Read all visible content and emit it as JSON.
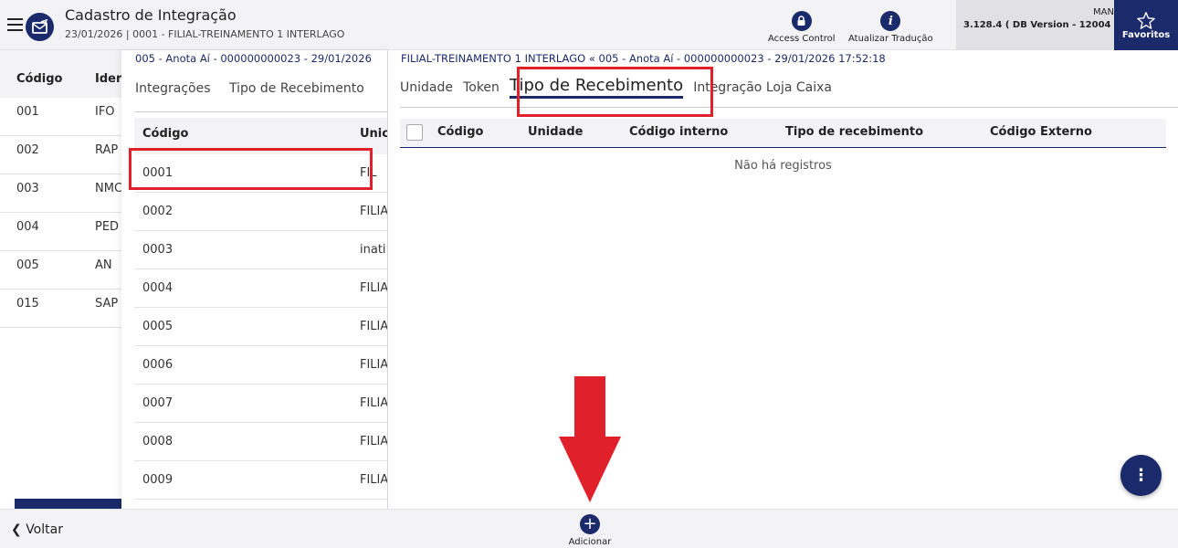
{
  "header": {
    "title": "Cadastro de Integração",
    "subtitle": "23/01/2026 | 0001 - FILIAL-TREINAMENTO 1 INTERLAGO",
    "access_control_label": "Access Control",
    "atualizar_traducao_label": "Atualizar Tradução",
    "user": "MAN",
    "version": "3.128.4 ( DB Version - 12004 )",
    "favoritos_label": "Favoritos"
  },
  "left_table": {
    "headers": [
      "Código",
      "Ider"
    ],
    "rows": [
      {
        "code": "001",
        "id": "IFO"
      },
      {
        "code": "002",
        "id": "RAP"
      },
      {
        "code": "003",
        "id": "NMC"
      },
      {
        "code": "004",
        "id": "PED"
      },
      {
        "code": "005",
        "id": "AN"
      },
      {
        "code": "015",
        "id": "SAP"
      }
    ]
  },
  "middle_panel": {
    "breadcrumb": "005 - Anota Aí - 000000000023 - 29/01/2026",
    "tabs": [
      "Integrações",
      "Tipo de Recebimento"
    ],
    "headers": [
      "Código",
      "Unic"
    ],
    "rows": [
      {
        "code": "0001",
        "unit": "FIL"
      },
      {
        "code": "0002",
        "unit": "FILIA"
      },
      {
        "code": "0003",
        "unit": "inati"
      },
      {
        "code": "0004",
        "unit": "FILIA"
      },
      {
        "code": "0005",
        "unit": "FILIA"
      },
      {
        "code": "0006",
        "unit": "FILIA"
      },
      {
        "code": "0007",
        "unit": "FILIA"
      },
      {
        "code": "0008",
        "unit": "FILIA"
      },
      {
        "code": "0009",
        "unit": "FILIA"
      }
    ]
  },
  "right_panel": {
    "breadcrumb": "FILIAL-TREINAMENTO 1 INTERLAGO « 005 - Anota Aí - 000000000023 - 29/01/2026 17:52:18",
    "tabs": [
      "Unidade",
      "Token",
      "Tipo de Recebimento",
      "Integração Loja Caixa"
    ],
    "active_tab": "Tipo de Recebimento",
    "headers": [
      "Código",
      "Unidade",
      "Código interno",
      "Tipo de recebimento",
      "Código Externo"
    ],
    "empty_message": "Não há registros",
    "fab_icon": "⋮"
  },
  "footer": {
    "back_label": "Voltar",
    "add_label": "Adicionar"
  },
  "colors": {
    "primary": "#1b2a6b",
    "highlight": "#e0202a"
  }
}
